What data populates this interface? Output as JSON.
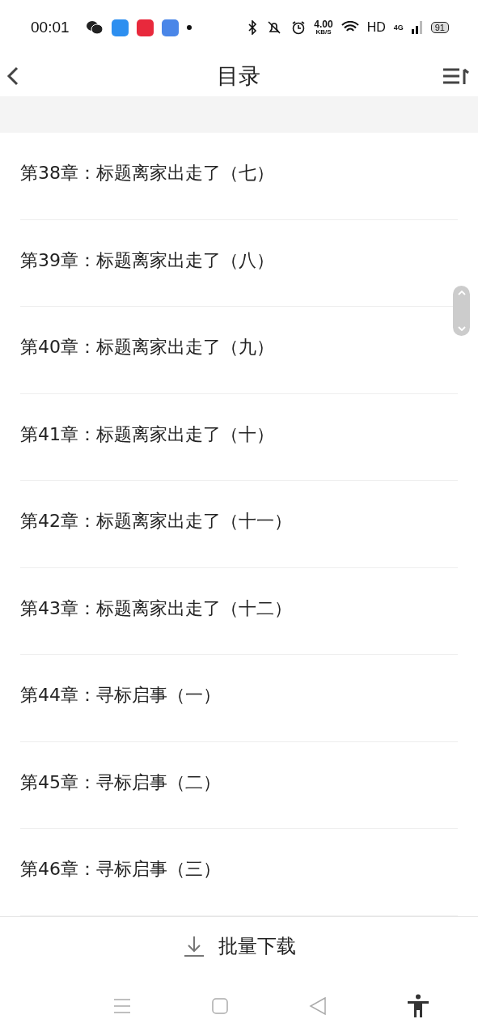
{
  "status_bar": {
    "time": "00:01",
    "speed_value": "4.00",
    "speed_unit": "KB/S",
    "hd": "HD",
    "network": "4G",
    "battery": "91"
  },
  "header": {
    "title": "目录"
  },
  "chapters": [
    {
      "title": "第38章：标题离家出走了（七）"
    },
    {
      "title": "第39章：标题离家出走了（八）"
    },
    {
      "title": "第40章：标题离家出走了（九）"
    },
    {
      "title": "第41章：标题离家出走了（十）"
    },
    {
      "title": "第42章：标题离家出走了（十一）"
    },
    {
      "title": "第43章：标题离家出走了（十二）"
    },
    {
      "title": "第44章：寻标启事（一）"
    },
    {
      "title": "第45章：寻标启事（二）"
    },
    {
      "title": "第46章：寻标启事（三）"
    }
  ],
  "batch_download": {
    "label": "批量下载"
  }
}
